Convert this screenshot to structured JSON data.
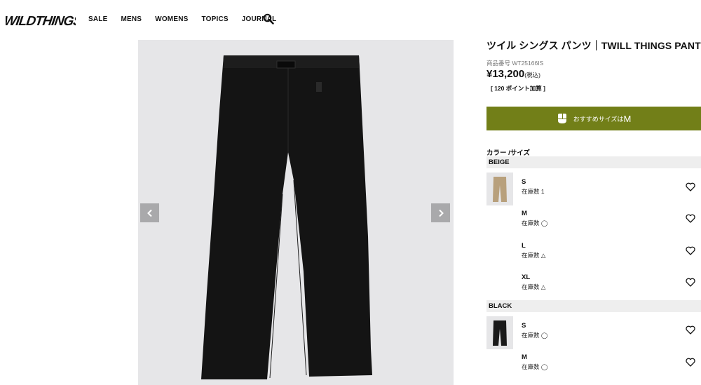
{
  "brand": {
    "logo_text": "WILD THINGS"
  },
  "nav": {
    "items": [
      "SALE",
      "MENS",
      "WOMENS",
      "TOPICS",
      "JOURNAL"
    ]
  },
  "product": {
    "title": "ツイル シングス パンツ｜TWILL THINGS PANTS",
    "sku": "商品番号 WT25166IS",
    "price": "¥13,200",
    "tax": "(税込)",
    "points": "[ 120 ポイント加算 ]",
    "size_recommend_label": "おすすめサイズは",
    "size_recommend_value": "M",
    "color_size_label": "カラー /サイズ"
  },
  "colors": [
    {
      "name": "BEIGE",
      "swatch": "#b8a07c",
      "sizes": [
        {
          "size": "S",
          "stock": "在庫数 1"
        },
        {
          "size": "M",
          "stock": "在庫数 ◯"
        },
        {
          "size": "L",
          "stock": "在庫数 △"
        },
        {
          "size": "XL",
          "stock": "在庫数 △"
        }
      ]
    },
    {
      "name": "BLACK",
      "swatch": "#1a1a1a",
      "sizes": [
        {
          "size": "S",
          "stock": "在庫数 ◯"
        },
        {
          "size": "M",
          "stock": "在庫数 ◯"
        }
      ]
    }
  ],
  "theme": {
    "accent": "#727f18",
    "gallery_bg": "#e6e6e8",
    "arrow_bg": "#a9a9ab"
  },
  "icons": {
    "search": "search-icon",
    "heart": "heart-icon",
    "prev": "chevron-left-icon",
    "next": "chevron-right-icon"
  }
}
